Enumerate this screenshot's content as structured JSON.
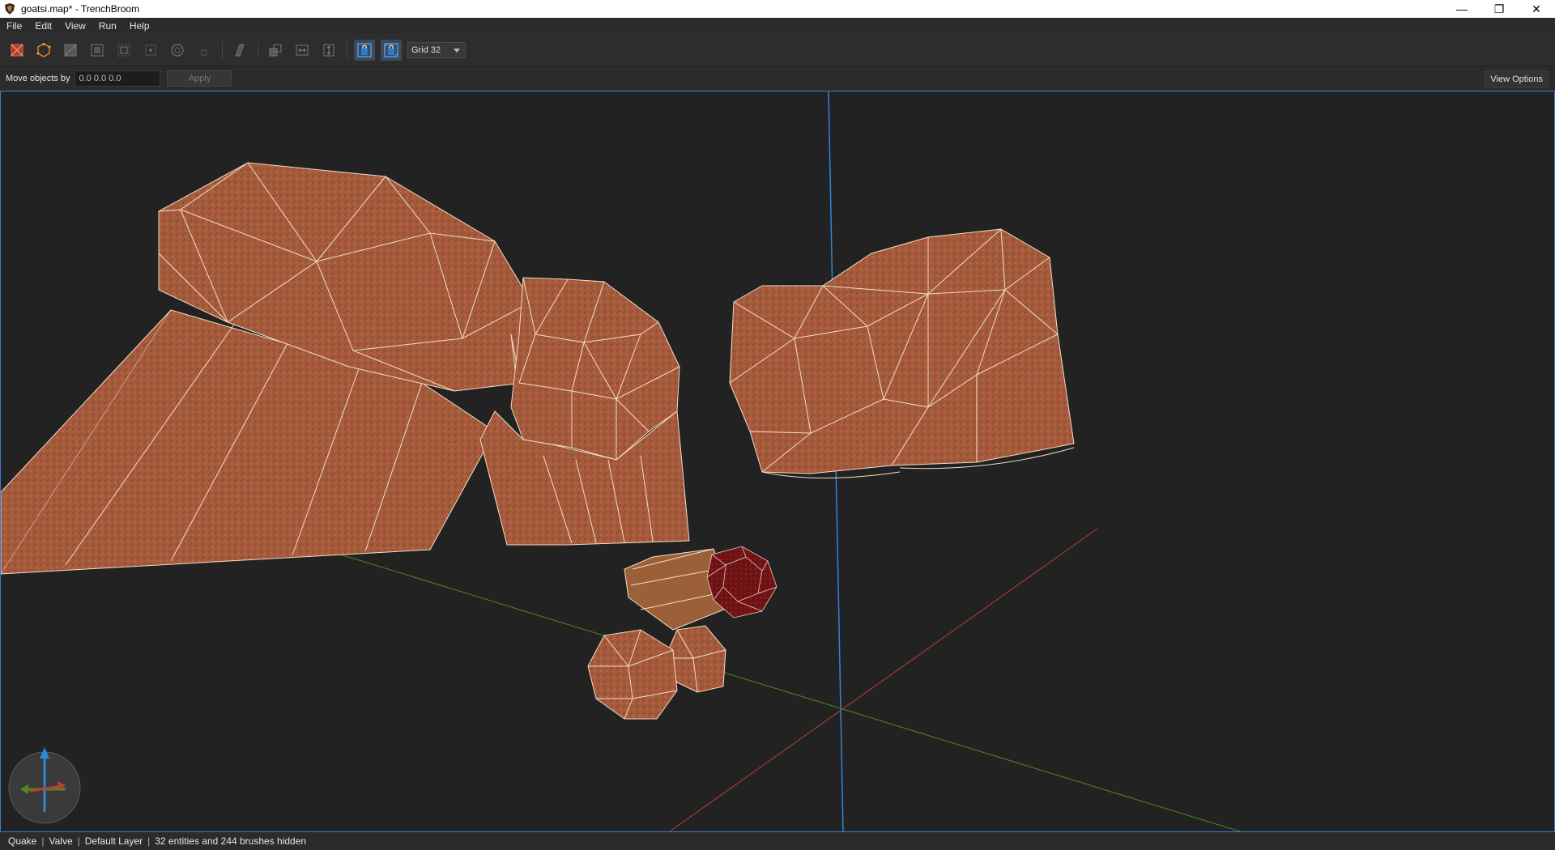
{
  "window": {
    "title": "goatsi.map* - TrenchBroom"
  },
  "window_controls": {
    "minimize": "—",
    "restore": "❐",
    "close": "✕"
  },
  "menu": [
    "File",
    "Edit",
    "View",
    "Run",
    "Help"
  ],
  "toolbar": {
    "tools": [
      "brush-tool-icon",
      "vertex-tool-icon",
      "edge-tool-icon",
      "face-tool-icon",
      "clip-tool-icon",
      "rotate-tool-icon",
      "scale-tool-icon",
      "shear-tool-icon",
      "csg-convex-icon",
      "csg-subtract-icon",
      "csg-hollow-icon",
      "csg-merge-icon",
      "texture-lock-icon",
      "uv-lock-icon"
    ],
    "grid_label": "Grid 32"
  },
  "move_bar": {
    "label": "Move objects by",
    "value": "0.0 0.0 0.0",
    "apply_label": "Apply",
    "view_options_label": "View Options"
  },
  "colors": {
    "viewport_bg": "#222222",
    "accent": "#3b7bd1",
    "brush_fill": "#a85a3c",
    "brush_edge": "#f3dcc8",
    "selected_face": "#7a1414",
    "axis_x": "#b8402e",
    "axis_y": "#4d8a1f",
    "axis_z": "#2e86d6"
  },
  "statusbar": {
    "game": "Quake",
    "format": "Valve",
    "layer": "Default Layer",
    "hidden_info": "32 entities and 244 brushes hidden"
  }
}
